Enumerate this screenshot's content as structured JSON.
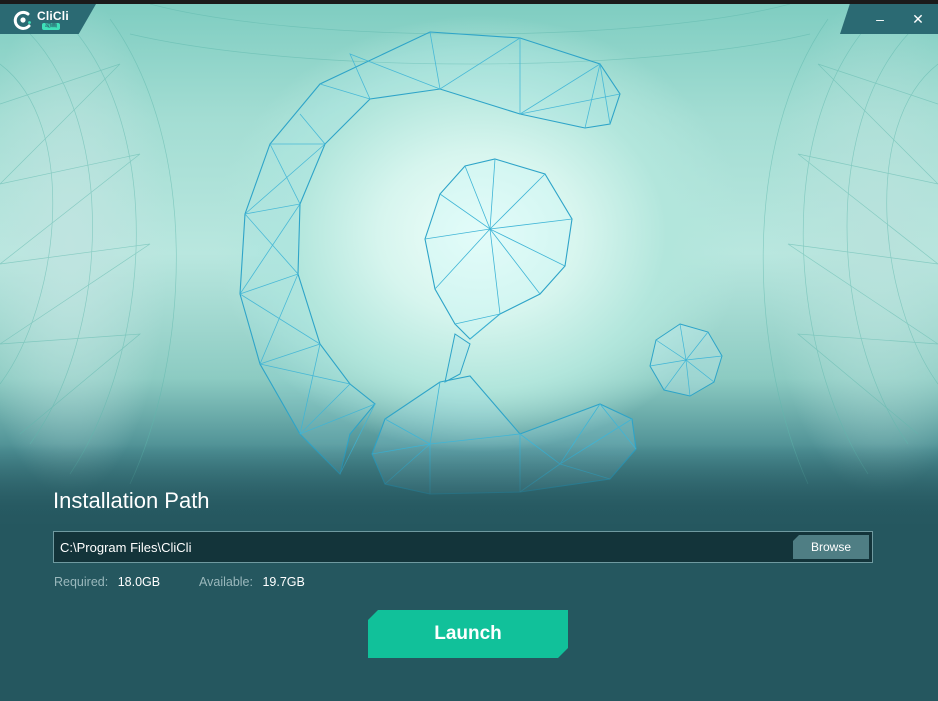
{
  "app": {
    "logo_text": "CliCli",
    "logo_badge": "动画"
  },
  "window_controls": {
    "minimize_icon": "minimize-icon",
    "close_icon": "close-icon",
    "minimize_glyph": "–",
    "close_glyph": "✕"
  },
  "install": {
    "title": "Installation Path",
    "path_value": "C:\\Program Files\\CliCli",
    "browse_label": "Browse",
    "required_label": "Required:",
    "required_value": "18.0GB",
    "available_label": "Available:",
    "available_value": "19.7GB",
    "launch_label": "Launch"
  },
  "colors": {
    "accent": "#11c19a",
    "panel_bg": "#25575f",
    "input_bg": "#13343a",
    "browse_bg": "#4f7e84"
  }
}
